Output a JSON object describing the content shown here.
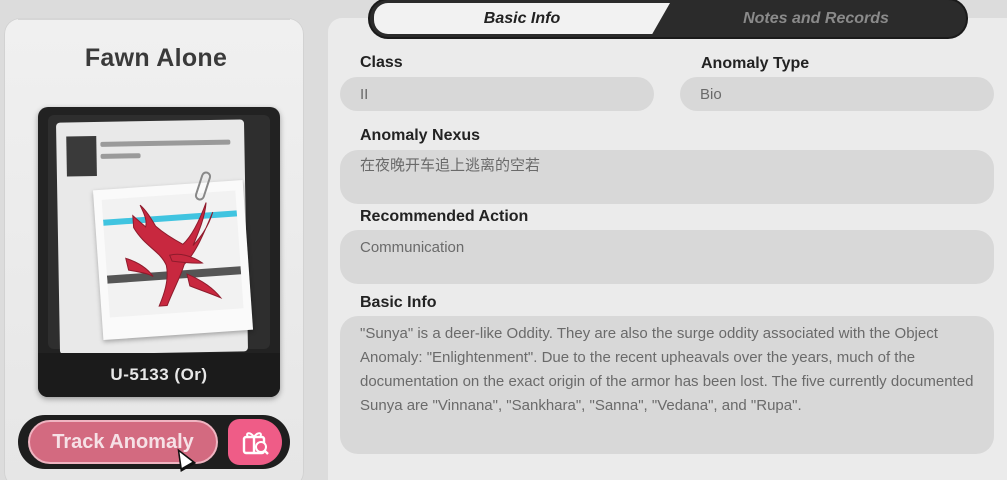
{
  "anomaly": {
    "name": "Fawn Alone",
    "code": "U-5133 (Or)"
  },
  "actions": {
    "track_label": "Track Anomaly",
    "gift_icon": "gift-search-icon"
  },
  "tabs": [
    {
      "label": "Basic Info",
      "active": true
    },
    {
      "label": "Notes and Records",
      "active": false
    }
  ],
  "fields": {
    "class": {
      "label": "Class",
      "value": "II"
    },
    "anomaly_type": {
      "label": "Anomaly Type",
      "value": "Bio"
    },
    "nexus": {
      "label": "Anomaly Nexus",
      "value": "在夜晚开车追上逃离的空若"
    },
    "action": {
      "label": "Recommended Action",
      "value": "Communication"
    },
    "basic_info": {
      "label": "Basic Info",
      "value": "\"Sunya\" is a deer-like Oddity. They are also the surge oddity associated with the Object Anomaly: \"Enlightenment\". Due to the recent upheavals over the years, much of the documentation on the exact origin of the armor has been lost. The five currently documented Sunya are \"Vinnana\", \"Sankhara\", \"Sanna\", \"Vedana\", and \"Rupa\"."
    }
  },
  "colors": {
    "accent_pink": "#ef5c87",
    "track_button": "#d36a80",
    "panel_bg": "#ebebeb",
    "field_bg": "#d8d8d8"
  }
}
